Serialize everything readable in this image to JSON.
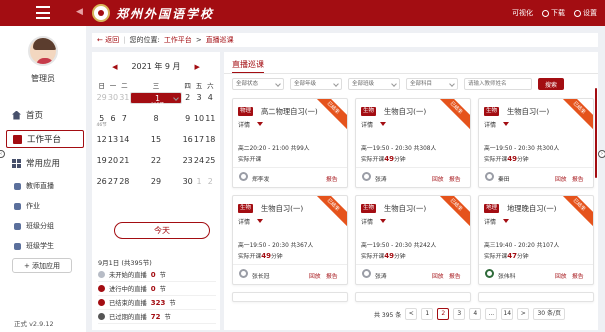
{
  "topbar": {
    "school_name": "郑州外国语学校",
    "actions": [
      {
        "label": "可视化",
        "icon": "chart-icon"
      },
      {
        "label": "下载",
        "icon": "download-icon"
      },
      {
        "label": "设置",
        "icon": "gear-icon"
      }
    ]
  },
  "sidebar": {
    "user": "管理员",
    "nav": [
      {
        "label": "首页",
        "icon": "home-icon",
        "active": false
      },
      {
        "label": "工作平台",
        "icon": "work-icon",
        "active": true
      },
      {
        "label": "常用应用",
        "icon": "apps-icon",
        "active": false
      }
    ],
    "apps": [
      "教师直播",
      "作业",
      "班级分组",
      "班级学生"
    ],
    "add_app": "+ 添加应用",
    "version": "正式 v2.9.12"
  },
  "breadcrumb": {
    "back": "← 返回",
    "prefix": "您的位置:",
    "path1": "工作平台",
    "path2": "直播巡课"
  },
  "calendar": {
    "title": "2021 年 9 月",
    "weekdays": [
      "日",
      "一",
      "二",
      "三",
      "四",
      "五",
      "六"
    ],
    "weeks": [
      [
        {
          "n": "29",
          "s": "",
          "m": true
        },
        {
          "n": "30",
          "s": "",
          "m": true
        },
        {
          "n": "31",
          "s": "",
          "m": true
        },
        {
          "n": "1",
          "s": "",
          "m": false
        },
        {
          "n": "2",
          "s": "",
          "m": false
        },
        {
          "n": "3",
          "s": "",
          "m": false
        },
        {
          "n": "4",
          "s": "",
          "m": false
        }
      ],
      [
        {
          "n": "5",
          "s": "46节",
          "m": false
        },
        {
          "n": "6",
          "s": "",
          "m": false
        },
        {
          "n": "7",
          "s": "",
          "m": false
        },
        {
          "n": "8",
          "s": "",
          "m": false
        },
        {
          "n": "9",
          "s": "",
          "m": false
        },
        {
          "n": "10",
          "s": "",
          "m": false
        },
        {
          "n": "11",
          "s": "",
          "m": false
        }
      ],
      [
        {
          "n": "12",
          "s": "",
          "m": false
        },
        {
          "n": "13",
          "s": "",
          "m": false
        },
        {
          "n": "14",
          "s": "",
          "m": false
        },
        {
          "n": "15",
          "s": "",
          "m": false
        },
        {
          "n": "16",
          "s": "",
          "m": false
        },
        {
          "n": "17",
          "s": "",
          "m": false
        },
        {
          "n": "18",
          "s": "",
          "m": false
        }
      ],
      [
        {
          "n": "19",
          "s": "",
          "m": false
        },
        {
          "n": "20",
          "s": "",
          "m": false
        },
        {
          "n": "21",
          "s": "",
          "m": false
        },
        {
          "n": "22",
          "s": "",
          "m": false
        },
        {
          "n": "23",
          "s": "",
          "m": false
        },
        {
          "n": "24",
          "s": "",
          "m": false
        },
        {
          "n": "25",
          "s": "",
          "m": false
        }
      ],
      [
        {
          "n": "26",
          "s": "",
          "m": false
        },
        {
          "n": "27",
          "s": "",
          "m": false
        },
        {
          "n": "28",
          "s": "",
          "m": false
        },
        {
          "n": "29",
          "s": "",
          "m": false
        },
        {
          "n": "30",
          "s": "",
          "m": false
        },
        {
          "n": "1",
          "s": "",
          "m": true
        },
        {
          "n": "2",
          "s": "",
          "m": true
        }
      ]
    ],
    "selected": {
      "week": 0,
      "day": 3,
      "sub": "395节"
    },
    "today_button": "今天",
    "date_info": "9月1日 (共395节)",
    "stats": [
      {
        "label": "未开始的直播",
        "count": "0",
        "unit": "节",
        "color": "#b7bcc6"
      },
      {
        "label": "进行中的直播",
        "count": "0",
        "unit": "节",
        "color": "#a30d12"
      },
      {
        "label": "已结束的直播",
        "count": "323",
        "unit": "节",
        "color": "#a30d12"
      },
      {
        "label": "已过期的直播",
        "count": "72",
        "unit": "节",
        "color": "#555555"
      }
    ]
  },
  "content": {
    "tab": "直播巡课",
    "filters": [
      "全部状态",
      "全部年级",
      "全部班级",
      "全部科目"
    ],
    "search_placeholder": "请输入教师姓名",
    "search_button": "搜索",
    "cards": [
      {
        "subject": "物理",
        "title": "高二物理自习(一)",
        "detail": "详情",
        "time": "高二20:20 - 21:00 共99人",
        "actual": "实际开课",
        "mins": "",
        "teacher": "郑李发",
        "replay": "",
        "report": "报告",
        "ribbon": "已结束",
        "avatar": "gray"
      },
      {
        "subject": "生物",
        "title": "生物自习(一)",
        "detail": "详情",
        "time": "高一19:50 - 20:30 共308人",
        "actual": "实际开课",
        "mins": "49",
        "teacher": "张涛",
        "replay": "回放",
        "report": "报告",
        "ribbon": "已结束",
        "avatar": "gray"
      },
      {
        "subject": "生物",
        "title": "生物自习(一)",
        "detail": "详情",
        "time": "高一19:50 - 20:30 共300人",
        "actual": "实际开课",
        "mins": "49",
        "teacher": "秦田",
        "replay": "回放",
        "report": "报告",
        "ribbon": "已结束",
        "avatar": "gray"
      },
      {
        "subject": "生物",
        "title": "生物自习(一)",
        "detail": "详情",
        "time": "高一19:50 - 20:30 共367人",
        "actual": "实际开课",
        "mins": "49",
        "teacher": "张长冠",
        "replay": "回放",
        "report": "报告",
        "ribbon": "已结束",
        "avatar": "gray"
      },
      {
        "subject": "生物",
        "title": "生物自习(一)",
        "detail": "详情",
        "time": "高一19:50 - 20:30 共242人",
        "actual": "实际开课",
        "mins": "49",
        "teacher": "张涛",
        "replay": "回放",
        "report": "报告",
        "ribbon": "已结束",
        "avatar": "gray"
      },
      {
        "subject": "地理",
        "title": "地理晚自习(一)",
        "detail": "详情",
        "time": "高三19:40 - 20:20 共107人",
        "actual": "实际开课",
        "mins": "47",
        "teacher": "张伟科",
        "replay": "回放",
        "report": "报告",
        "ribbon": "已结束",
        "avatar": "green"
      }
    ],
    "pager": {
      "total": "共 395 条",
      "prev": "<",
      "pages": [
        "1",
        "2",
        "3",
        "4",
        "...",
        "14"
      ],
      "current": "2",
      "next": ">",
      "size": "30 条/页"
    }
  },
  "labels": {
    "mins_prefix": "实际开课",
    "mins_suffix": "分钟"
  }
}
